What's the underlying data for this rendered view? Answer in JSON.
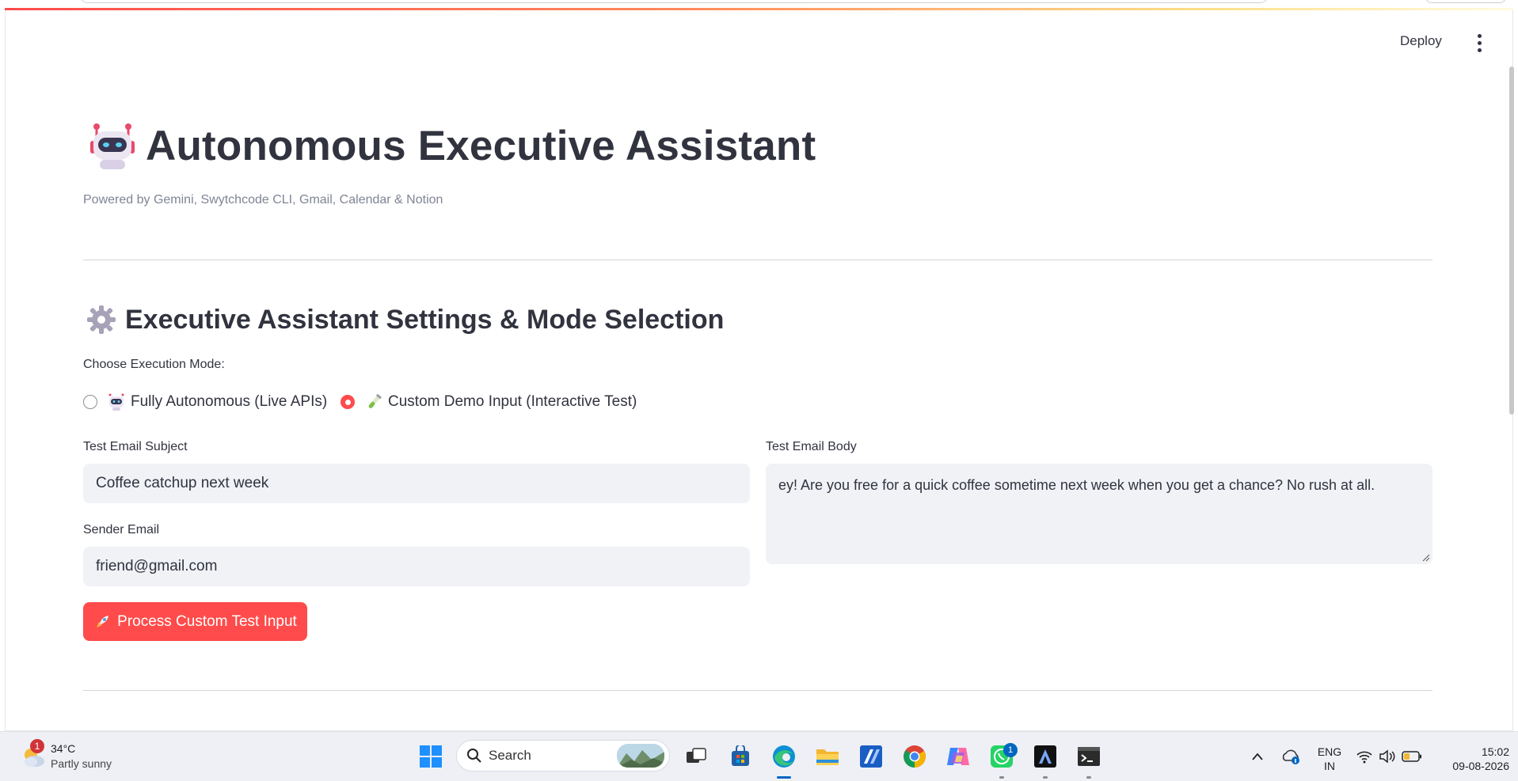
{
  "header": {
    "deploy_label": "Deploy"
  },
  "page": {
    "title": "Autonomous Executive Assistant",
    "subtitle": "Powered by Gemini, Swytchcode CLI, Gmail, Calendar & Notion"
  },
  "settings": {
    "section_title": "Executive Assistant Settings & Mode Selection",
    "mode_label": "Choose Execution Mode:",
    "options": [
      {
        "label": "Fully Autonomous (Live APIs)",
        "selected": false,
        "icon": "robot-icon"
      },
      {
        "label": "Custom Demo Input (Interactive Test)",
        "selected": true,
        "icon": "test-tube-icon"
      }
    ],
    "subject_label": "Test Email Subject",
    "subject_value": "Coffee catchup next week",
    "body_label": "Test Email Body",
    "body_value": "ey! Are you free for a quick coffee sometime next week when you get a chance? No rush at all.",
    "sender_label": "Sender Email",
    "sender_value": "friend@gmail.com",
    "process_button": "Process Custom Test Input"
  },
  "taskbar": {
    "weather_badge": "1",
    "weather_temp": "34°C",
    "weather_condition": "Partly sunny",
    "search_label": "Search",
    "whatsapp_badge": "1",
    "lang_line1": "ENG",
    "lang_line2": "IN",
    "time": "15:02",
    "date": "09-08-2026"
  },
  "colors": {
    "accent": "#ff4b4b",
    "input_bg": "#f0f2f6",
    "text": "#31333f",
    "muted": "#808495"
  }
}
